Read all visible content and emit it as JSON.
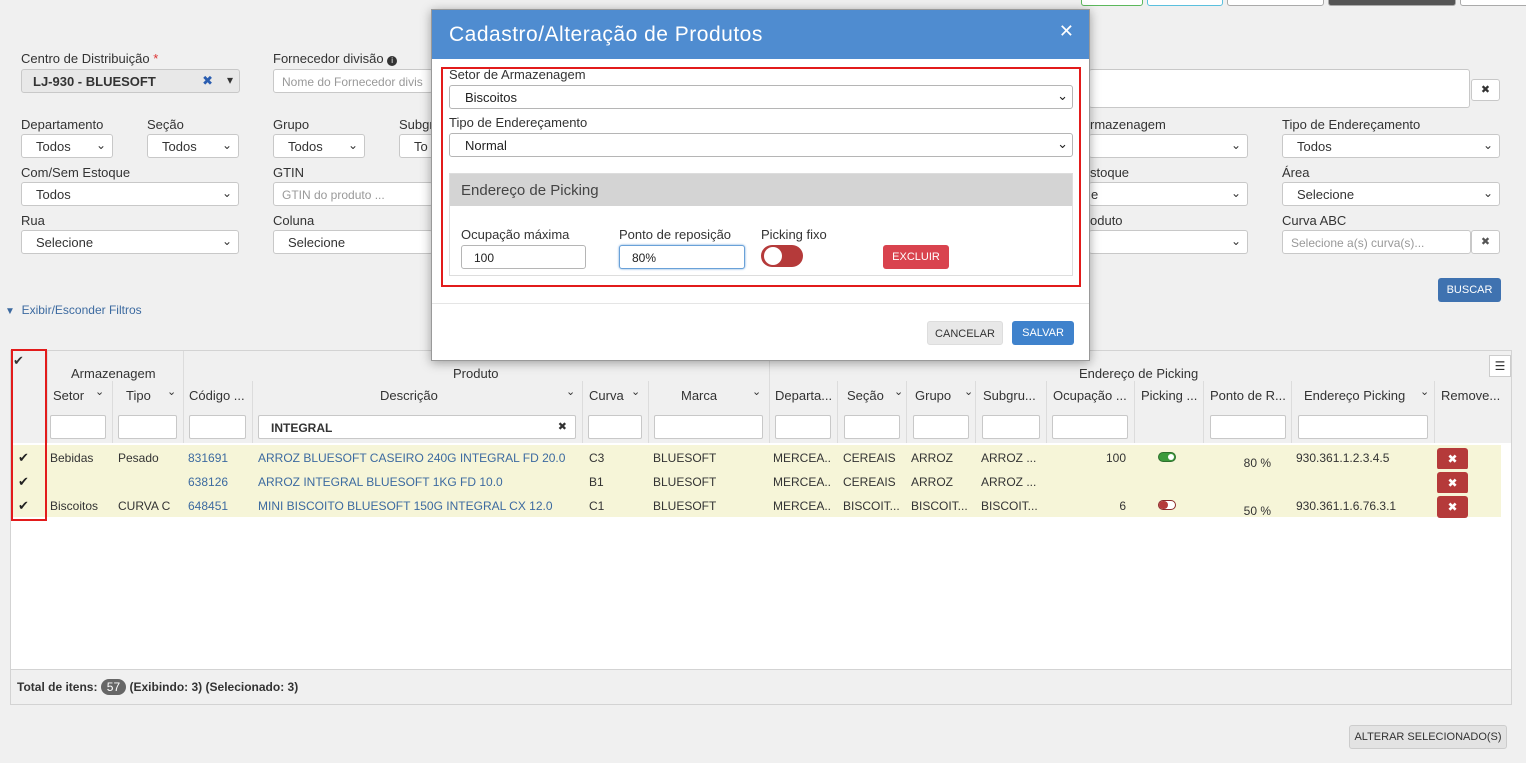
{
  "filters": {
    "cd_label": "Centro de Distribuição",
    "cd_required": "*",
    "cd_value": "LJ-930 - BLUESOFT",
    "fornecedor_label": "Fornecedor divisão",
    "fornecedor_placeholder": "Nome do Fornecedor divis",
    "departamento_label": "Departamento",
    "departamento_value": "Todos",
    "secao_label": "Seção",
    "secao_value": "Todos",
    "grupo_label": "Grupo",
    "grupo_value": "Todos",
    "subgrupo_label": "Subgr",
    "subgrupo_value": "To",
    "armazenagem_label": "rmazenagem",
    "tipo_end_label": "Tipo de Endereçamento",
    "tipo_end_value": "Todos",
    "com_sem_label": "Com/Sem Estoque",
    "com_sem_value": "Todos",
    "gtin_label": "GTIN",
    "gtin_placeholder": "GTIN do produto ...",
    "estoque_label": "stoque",
    "estoque_value": "e",
    "area_label": "Área",
    "area_value": "Selecione",
    "rua_label": "Rua",
    "rua_value": "Selecione",
    "coluna_label": "Coluna",
    "coluna_value": "Selecione",
    "produto_label": "oduto",
    "curva_label": "Curva ABC",
    "curva_placeholder": "Selecione a(s) curva(s)...",
    "buscar_label": "BUSCAR",
    "toggle_filters_label": "Exibir/Esconder Filtros"
  },
  "grid": {
    "group_armazenagem": "Armazenagem",
    "group_produto": "Produto",
    "group_endereco": "Endereço de Picking",
    "columns": [
      "Setor",
      "Tipo",
      "Código ...",
      "Descrição",
      "Curva",
      "Marca",
      "Departa...",
      "Seção",
      "Grupo",
      "Subgru...",
      "Ocupação ...",
      "Picking ...",
      "Ponto de R...",
      "Endereço Picking",
      "Remove..."
    ],
    "descricao_filter": "INTEGRAL",
    "rows": [
      {
        "setor": "Bebidas",
        "tipo": "Pesado",
        "codigo": "831691",
        "descricao": "ARROZ BLUESOFT CASEIRO 240G INTEGRAL FD 20.0",
        "curva": "C3",
        "marca": "BLUESOFT",
        "depto": "MERCEA...",
        "secao": "CEREAIS",
        "grupo": "ARROZ",
        "subgrupo": "ARROZ ...",
        "ocupacao": "100",
        "ponto": "80 %",
        "endereco": "930.361.1.2.3.4.5"
      },
      {
        "setor": "",
        "tipo": "",
        "codigo": "638126",
        "descricao": "ARROZ INTEGRAL BLUESOFT 1KG FD 10.0",
        "curva": "B1",
        "marca": "BLUESOFT",
        "depto": "MERCEA...",
        "secao": "CEREAIS",
        "grupo": "ARROZ",
        "subgrupo": "ARROZ ...",
        "ocupacao": "",
        "ponto": "",
        "endereco": ""
      },
      {
        "setor": "Biscoitos",
        "tipo": "CURVA C",
        "codigo": "648451",
        "descricao": "MINI BISCOITO BLUESOFT 150G INTEGRAL CX 12.0",
        "curva": "C1",
        "marca": "BLUESOFT",
        "depto": "MERCEA...",
        "secao": "BISCOIT...",
        "grupo": "BISCOIT...",
        "subgrupo": "BISCOIT...",
        "ocupacao": "6",
        "ponto": "50 %",
        "endereco": "930.361.1.6.76.3.1"
      }
    ],
    "footer_total_label": "Total de itens:",
    "footer_total": "57",
    "footer_exibindo": "(Exibindo: 3)",
    "footer_selecionado": "(Selecionado: 3)"
  },
  "bottom": {
    "alterar_label": "ALTERAR SELECIONADO(S)"
  },
  "modal": {
    "title": "Cadastro/Alteração de Produtos",
    "setor_label": "Setor de Armazenagem",
    "setor_value": "Biscoitos",
    "tipo_label": "Tipo de Endereçamento",
    "tipo_value": "Normal",
    "panel_title": "Endereço de Picking",
    "ocupacao_label": "Ocupação máxima",
    "ocupacao_value": "100",
    "ponto_label": "Ponto de reposição",
    "ponto_value": "80%",
    "picking_label": "Picking fixo",
    "excluir_label": "EXCLUIR",
    "cancelar_label": "CANCELAR",
    "salvar_label": "SALVAR"
  },
  "colors": {
    "accent": "#4f8cd0",
    "danger": "#b53a3a",
    "highlight_row": "#f6f5d8",
    "outline_red": "#e21b1b"
  }
}
